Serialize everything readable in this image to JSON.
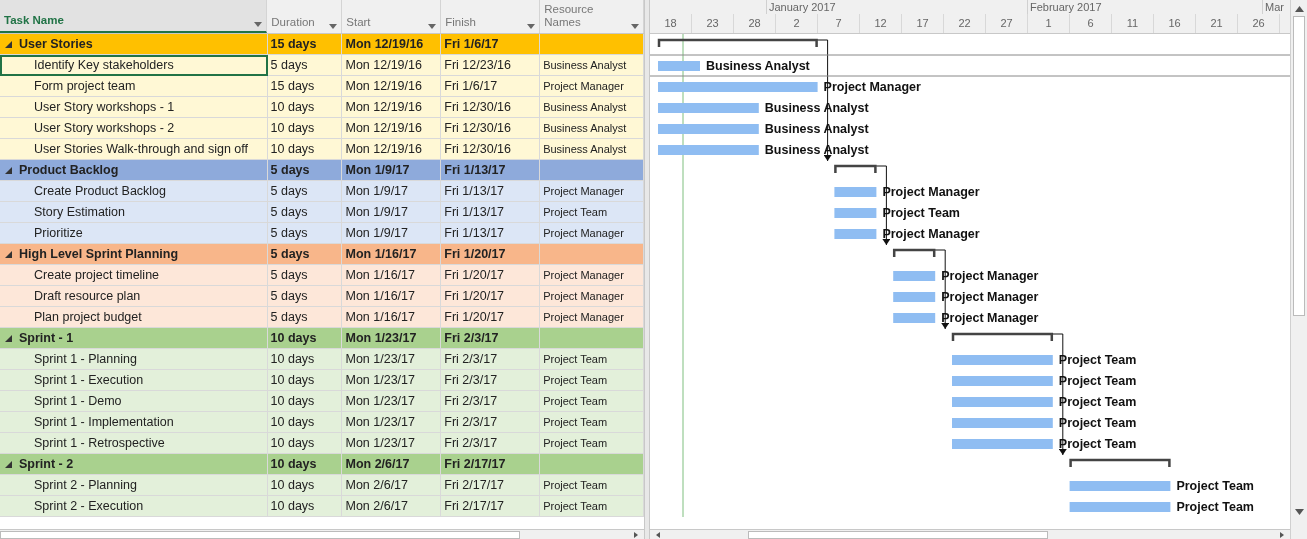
{
  "table": {
    "columns": [
      {
        "label": "Task Name",
        "selected": true
      },
      {
        "label": "Duration",
        "selected": false
      },
      {
        "label": "Start",
        "selected": false
      },
      {
        "label": "Finish",
        "selected": false
      },
      {
        "label": "Resource Names",
        "selected": false
      }
    ]
  },
  "rows": [
    {
      "kind": "summary",
      "name": "User Stories",
      "expanded": true,
      "duration": "15 days",
      "start": "Mon 12/19/16",
      "finish": "Fri 1/6/17",
      "color": "#ffc000",
      "selected": false
    },
    {
      "kind": "task",
      "name": "Identify Key stakeholders",
      "duration": "5 days",
      "start": "Mon 12/19/16",
      "finish": "Fri 12/23/16",
      "resource": "Business Analyst",
      "gantt_label": "Business Analyst",
      "color": "#fff8d5",
      "selected": true
    },
    {
      "kind": "task",
      "name": "Form project team",
      "duration": "15 days",
      "start": "Mon 12/19/16",
      "finish": "Fri 1/6/17",
      "resource": "Project Manager",
      "gantt_label": "Project Manager",
      "color": "#fff8d5",
      "selected": false
    },
    {
      "kind": "task",
      "name": "User Story workshops - 1",
      "duration": "10 days",
      "start": "Mon 12/19/16",
      "finish": "Fri 12/30/16",
      "resource": "Business Analyst",
      "gantt_label": "Business Analyst",
      "color": "#fff8d5",
      "selected": false
    },
    {
      "kind": "task",
      "name": "User Story workshops - 2",
      "duration": "10 days",
      "start": "Mon 12/19/16",
      "finish": "Fri 12/30/16",
      "resource": "Business Analyst",
      "gantt_label": "Business Analyst",
      "color": "#fff8d5",
      "selected": false
    },
    {
      "kind": "task",
      "name": "User Stories Walk-through and sign off",
      "duration": "10 days",
      "start": "Mon 12/19/16",
      "finish": "Fri 12/30/16",
      "resource": "Business Analyst",
      "gantt_label": "Business Analyst",
      "color": "#fff8d5",
      "selected": false
    },
    {
      "kind": "summary",
      "name": "Product Backlog",
      "expanded": true,
      "duration": "5 days",
      "start": "Mon 1/9/17",
      "finish": "Fri 1/13/17",
      "color": "#8eaadb",
      "selected": false
    },
    {
      "kind": "task",
      "name": "Create Product Backlog",
      "duration": "5 days",
      "start": "Mon 1/9/17",
      "finish": "Fri 1/13/17",
      "resource": "Project Manager",
      "gantt_label": "Project Manager",
      "color": "#dce6f6",
      "selected": false
    },
    {
      "kind": "task",
      "name": "Story Estimation",
      "duration": "5 days",
      "start": "Mon 1/9/17",
      "finish": "Fri 1/13/17",
      "resource": "Project Team",
      "gantt_label": "Project Team",
      "color": "#dce6f6",
      "selected": false
    },
    {
      "kind": "task",
      "name": "Prioritize",
      "duration": "5 days",
      "start": "Mon 1/9/17",
      "finish": "Fri 1/13/17",
      "resource": "Project Manager",
      "gantt_label": "Project Manager",
      "color": "#dce6f6",
      "selected": false
    },
    {
      "kind": "summary",
      "name": "High Level Sprint Planning",
      "expanded": true,
      "duration": "5 days",
      "start": "Mon 1/16/17",
      "finish": "Fri 1/20/17",
      "color": "#f8b68a",
      "selected": false
    },
    {
      "kind": "task",
      "name": "Create project timeline",
      "duration": "5 days",
      "start": "Mon 1/16/17",
      "finish": "Fri 1/20/17",
      "resource": "Project Manager",
      "gantt_label": "Project Manager",
      "color": "#fde7d9",
      "selected": false
    },
    {
      "kind": "task",
      "name": "Draft resource plan",
      "duration": "5 days",
      "start": "Mon 1/16/17",
      "finish": "Fri 1/20/17",
      "resource": "Project Manager",
      "gantt_label": "Project Manager",
      "color": "#fde7d9",
      "selected": false
    },
    {
      "kind": "task",
      "name": "Plan project budget",
      "duration": "5 days",
      "start": "Mon 1/16/17",
      "finish": "Fri 1/20/17",
      "resource": "Project Manager",
      "gantt_label": "Project Manager",
      "color": "#fde7d9",
      "selected": false
    },
    {
      "kind": "summary",
      "name": "Sprint - 1",
      "expanded": true,
      "duration": "10 days",
      "start": "Mon 1/23/17",
      "finish": "Fri 2/3/17",
      "color": "#a9d18e",
      "selected": false
    },
    {
      "kind": "task",
      "name": "Sprint 1 - Planning",
      "duration": "10 days",
      "start": "Mon 1/23/17",
      "finish": "Fri 2/3/17",
      "resource": "Project Team",
      "gantt_label": "Project Team",
      "color": "#e3f0da",
      "selected": false
    },
    {
      "kind": "task",
      "name": "Sprint 1 - Execution",
      "duration": "10 days",
      "start": "Mon 1/23/17",
      "finish": "Fri 2/3/17",
      "resource": "Project Team",
      "gantt_label": "Project Team",
      "color": "#e3f0da",
      "selected": false
    },
    {
      "kind": "task",
      "name": "Sprint 1 - Demo",
      "duration": "10 days",
      "start": "Mon 1/23/17",
      "finish": "Fri 2/3/17",
      "resource": "Project Team",
      "gantt_label": "Project Team",
      "color": "#e3f0da",
      "selected": false
    },
    {
      "kind": "task",
      "name": "Sprint 1 - Implementation",
      "duration": "10 days",
      "start": "Mon 1/23/17",
      "finish": "Fri 2/3/17",
      "resource": "Project Team",
      "gantt_label": "Project Team",
      "color": "#e3f0da",
      "selected": false
    },
    {
      "kind": "task",
      "name": "Sprint 1 - Retrospective",
      "duration": "10 days",
      "start": "Mon 1/23/17",
      "finish": "Fri 2/3/17",
      "resource": "Project Team",
      "gantt_label": "Project Team",
      "color": "#e3f0da",
      "selected": false
    },
    {
      "kind": "summary",
      "name": "Sprint - 2",
      "expanded": true,
      "duration": "10 days",
      "start": "Mon 2/6/17",
      "finish": "Fri 2/17/17",
      "color": "#a9d18e",
      "selected": false
    },
    {
      "kind": "task",
      "name": "Sprint 2 - Planning",
      "duration": "10 days",
      "start": "Mon 2/6/17",
      "finish": "Fri 2/17/17",
      "resource": "Project Team",
      "gantt_label": "Project Team",
      "color": "#e3f0da",
      "selected": false
    },
    {
      "kind": "task",
      "name": "Sprint 2 - Execution",
      "duration": "10 days",
      "start": "Mon 2/6/17",
      "finish": "Fri 2/17/17",
      "resource": "Project Team",
      "gantt_label": "Project Team",
      "color": "#e3f0da",
      "selected": false
    }
  ],
  "timeline": {
    "months": [
      "January 2017",
      "February 2017",
      "Mar"
    ],
    "days": [
      "18",
      "23",
      "28",
      "2",
      "7",
      "12",
      "17",
      "22",
      "27",
      "1",
      "6",
      "11",
      "16",
      "21",
      "26"
    ]
  }
}
